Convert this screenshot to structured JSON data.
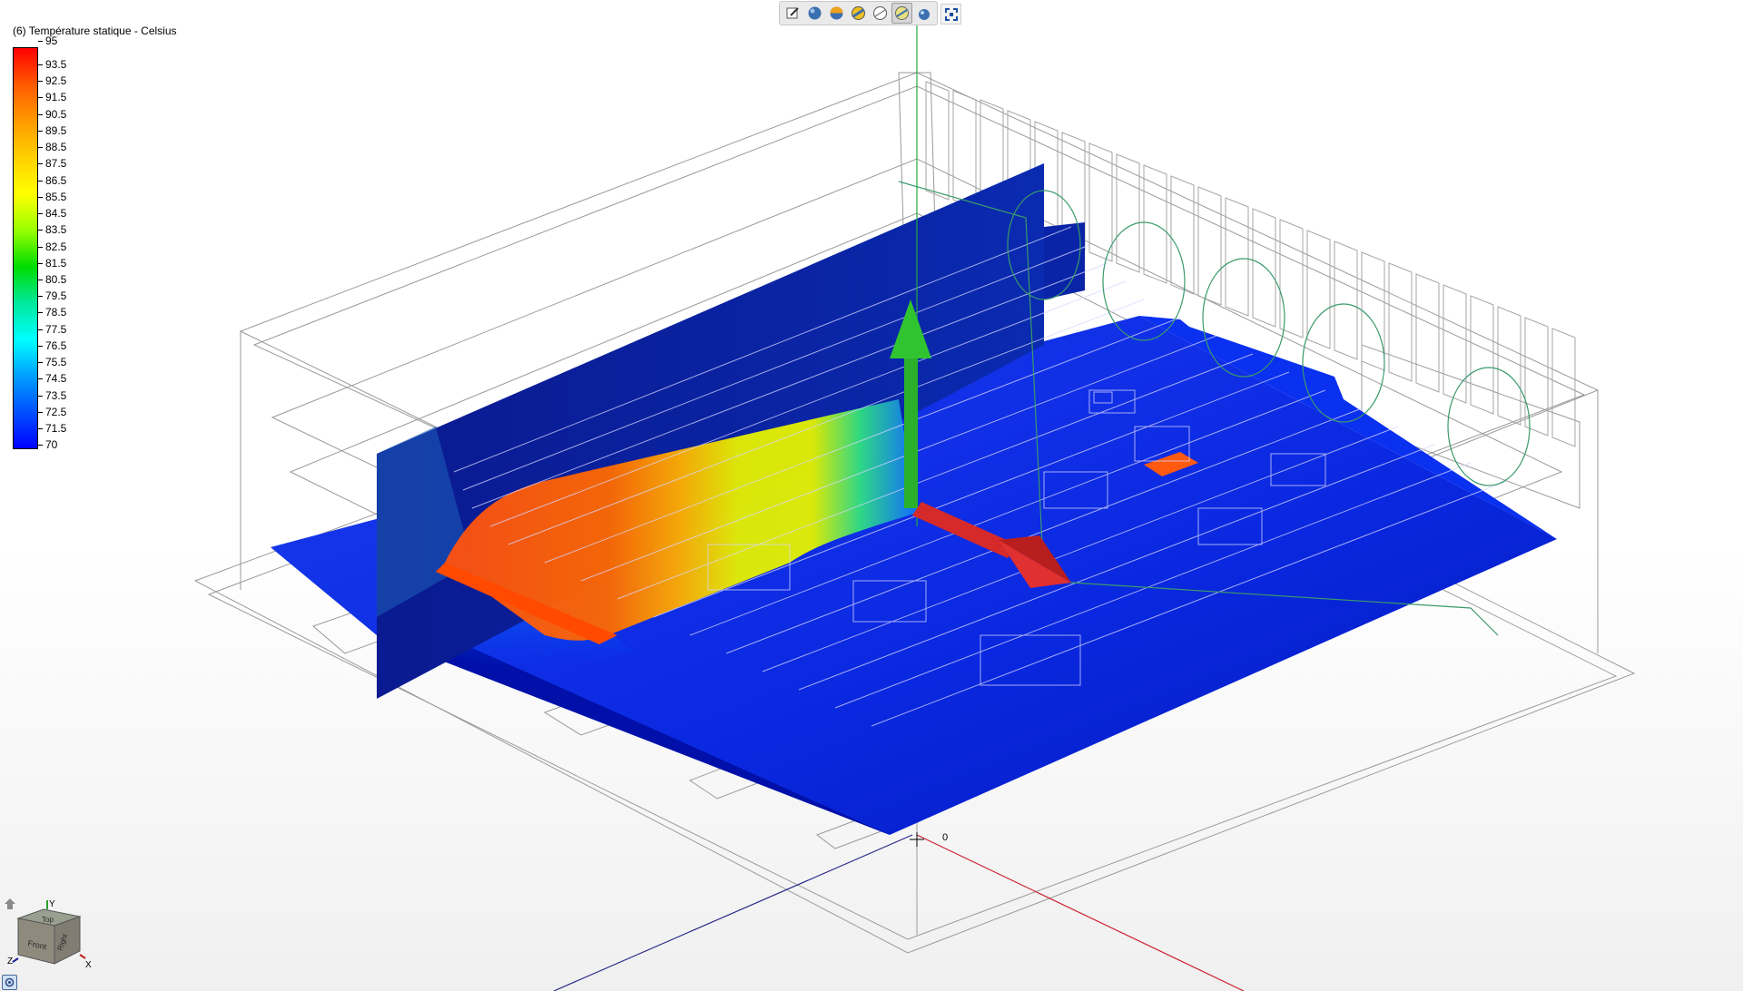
{
  "legend": {
    "title": "(6) Température statique - Celsius",
    "labels": [
      "95",
      "93.5",
      "92.5",
      "91.5",
      "90.5",
      "89.5",
      "88.5",
      "87.5",
      "86.5",
      "85.5",
      "84.5",
      "83.5",
      "82.5",
      "81.5",
      "80.5",
      "79.5",
      "78.5",
      "77.5",
      "76.5",
      "75.5",
      "74.5",
      "73.5",
      "72.5",
      "71.5",
      "70"
    ],
    "gradient_colors": [
      "#ff0000",
      "#ff5a00",
      "#ff9a00",
      "#ffd000",
      "#ffff00",
      "#9aff00",
      "#00dd00",
      "#00e89a",
      "#00ffff",
      "#00a0ff",
      "#0050ff",
      "#0000ff"
    ]
  },
  "toolbar": {
    "icons": [
      "edit-icon",
      "shaded-sphere-icon",
      "section-sphere-icon",
      "edges-sphere-icon",
      "wireframe-icon",
      "transparent-icon",
      "perspective-icon"
    ],
    "active_index": 5,
    "fit_icon": "fit-view-icon"
  },
  "viewport": {
    "origin_label": "0",
    "plane_colors": {
      "cold": "#0a1fd0",
      "hot": "#ff5a10",
      "warm": "#e8f000",
      "mid": "#00c87a"
    },
    "axis_colors": {
      "x": "#cc2233",
      "y": "#22aa44",
      "z": "#2a2a8a"
    }
  },
  "nav_cube": {
    "faces": {
      "top": "Top",
      "front": "Front",
      "right": "Right"
    },
    "axes": {
      "x": "X",
      "y": "Y",
      "z": "Z"
    }
  }
}
